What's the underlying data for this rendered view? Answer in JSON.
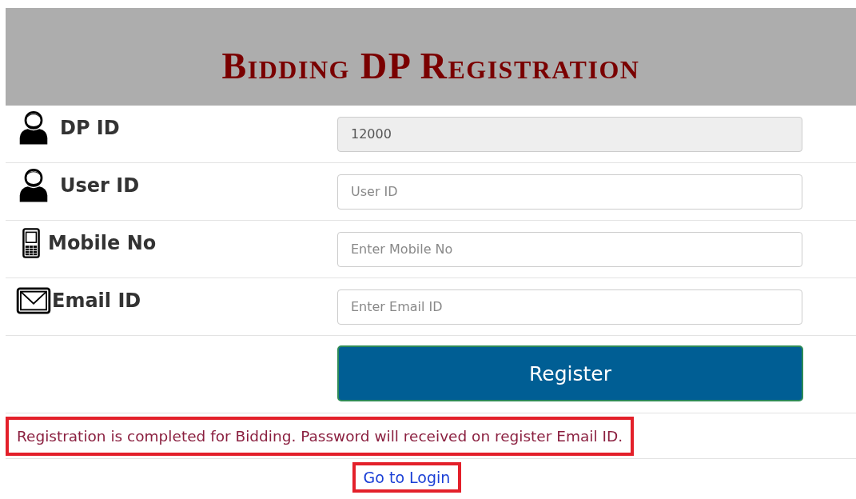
{
  "header": {
    "title": "Bidding DP Registration"
  },
  "fields": [
    {
      "kind": "person",
      "label": "DP ID",
      "value": "12000",
      "disabled": true
    },
    {
      "kind": "person",
      "label": "User ID",
      "placeholder": "User ID",
      "disabled": false
    },
    {
      "kind": "mobile",
      "label": "Mobile No",
      "placeholder": "Enter Mobile No",
      "disabled": false
    },
    {
      "kind": "mail",
      "label": "Email ID",
      "placeholder": "Enter Email ID",
      "disabled": false
    }
  ],
  "register_button": "Register",
  "message": {
    "text": "Registration is completed for Bidding. Password will received on register Email ID.",
    "highlighted": true
  },
  "login_link": {
    "text": "Go to Login",
    "highlighted": true
  }
}
